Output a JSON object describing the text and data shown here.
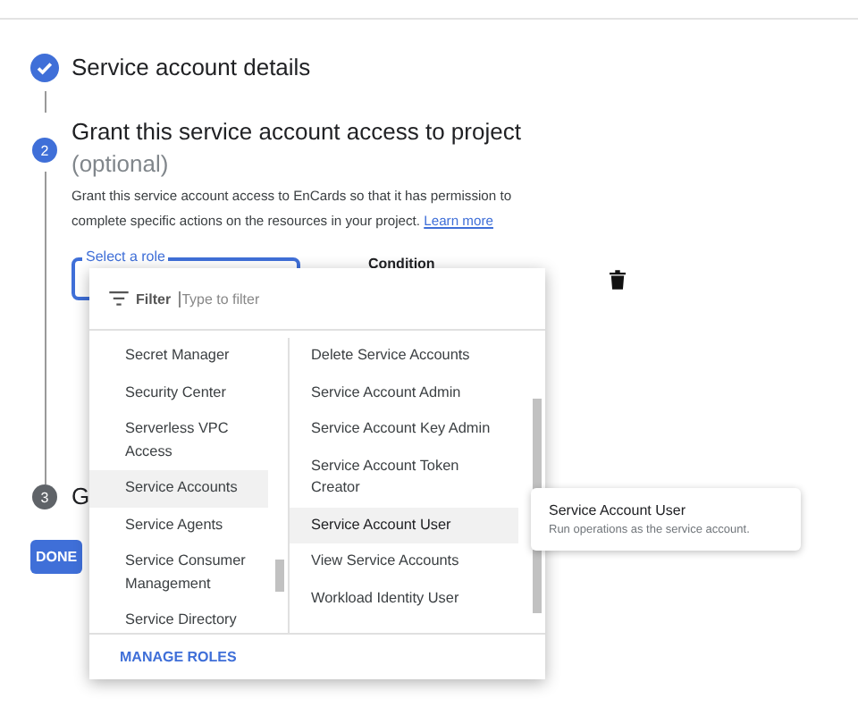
{
  "steps": [
    {
      "completed": true,
      "active": false,
      "title": "Service account details"
    },
    {
      "number": "2",
      "completed": false,
      "active": true,
      "title": "Grant this service account access to project",
      "subtitle": "(optional)",
      "description": "Grant this service account access to EnCards so that it has permission to complete specific actions on the resources in your project.",
      "link": "Learn more"
    },
    {
      "number": "3",
      "completed": false,
      "active": false,
      "title": "G"
    }
  ],
  "role_field": {
    "label": "Select a role",
    "focused": true
  },
  "condition_label": "Condition",
  "done_button": "DONE",
  "dropdown": {
    "filter_label": "Filter",
    "filter_placeholder": "Type to filter",
    "services": [
      {
        "label": "Secret Manager",
        "selected": false
      },
      {
        "label": "Security Center",
        "selected": false
      },
      {
        "label": "Serverless VPC Access",
        "selected": false
      },
      {
        "label": "Service Accounts",
        "selected": true
      },
      {
        "label": "Service Agents",
        "selected": false
      },
      {
        "label": "Service Consumer Management",
        "selected": false
      },
      {
        "label": "Service Directory",
        "selected": false
      }
    ],
    "roles": [
      {
        "label": "Delete Service Accounts",
        "hovered": false
      },
      {
        "label": "Service Account Admin",
        "hovered": false
      },
      {
        "label": "Service Account Key Admin",
        "hovered": false
      },
      {
        "label": "Service Account Token Creator",
        "hovered": false
      },
      {
        "label": "Service Account User",
        "hovered": true
      },
      {
        "label": "View Service Accounts",
        "hovered": false
      },
      {
        "label": "Workload Identity User",
        "hovered": false
      }
    ],
    "footer_button": "MANAGE ROLES"
  },
  "tooltip": {
    "title": "Service Account User",
    "text": "Run operations as the service account."
  }
}
